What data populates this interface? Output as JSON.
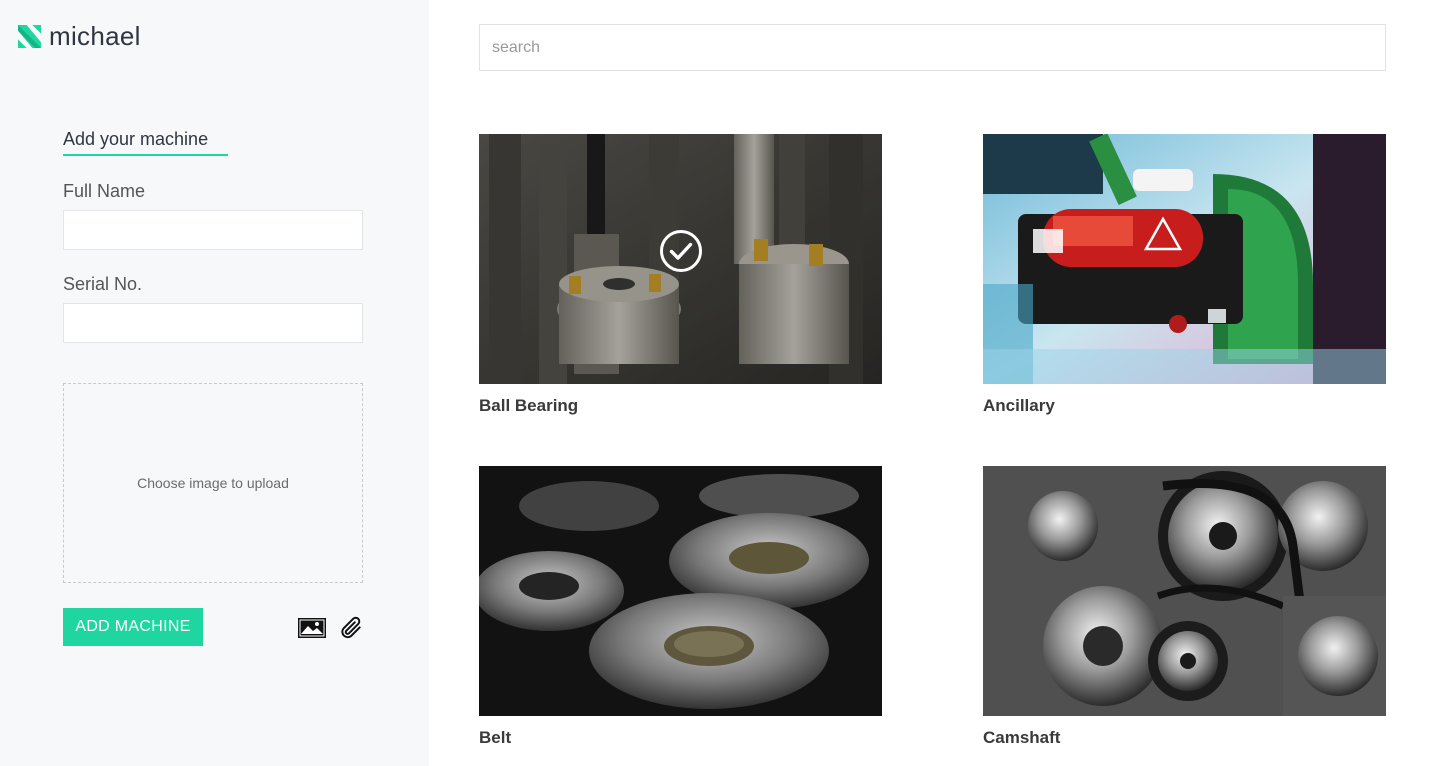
{
  "brand": {
    "name": "michael",
    "logo_icon": "brand-logo-icon",
    "accent": "#1fd6a0"
  },
  "form": {
    "heading": "Add your machine",
    "full_name_label": "Full Name",
    "full_name_value": "",
    "serial_label": "Serial No.",
    "serial_value": "",
    "upload_text": "Choose image to upload",
    "submit_label": "ADD MACHINE"
  },
  "search": {
    "placeholder": "search",
    "value": ""
  },
  "machines": [
    {
      "title": "Ball Bearing",
      "selected": true,
      "icon": "check-circle-icon"
    },
    {
      "title": "Ancillary",
      "selected": false
    },
    {
      "title": "Belt",
      "selected": false
    },
    {
      "title": "Camshaft",
      "selected": false
    }
  ]
}
